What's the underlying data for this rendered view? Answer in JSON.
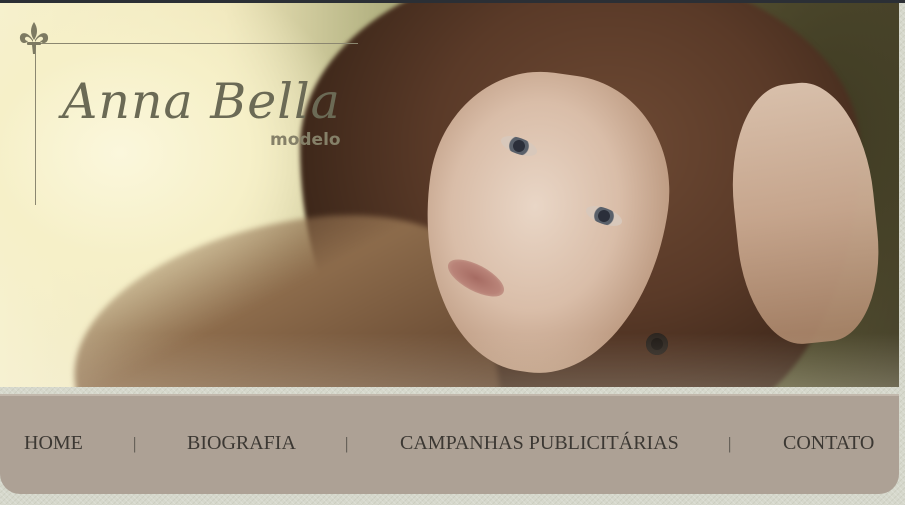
{
  "logo": {
    "name": "Anna Bella",
    "subtitle": "modelo",
    "emblem_icon": "fleur-de-lis-icon",
    "color": "#6b6a55"
  },
  "nav": {
    "items": [
      {
        "label": "HOME"
      },
      {
        "label": "BIOGRAFIA"
      },
      {
        "label": "CAMPANHAS PUBLICITÁRIAS"
      },
      {
        "label": "CONTATO"
      }
    ],
    "separator": "|",
    "background_color": "#ada195",
    "text_color": "#3c3833"
  },
  "banner": {
    "image": "model-portrait-photo"
  }
}
